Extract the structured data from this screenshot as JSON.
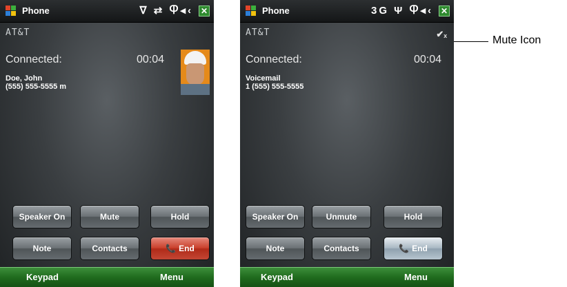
{
  "left_phone": {
    "app_title": "Phone",
    "status_icons": "ᐁ ⇄ Ⴔ◂‹",
    "close_label": "✕",
    "carrier": "AT&T",
    "call_state": "Connected:",
    "call_timer": "00:04",
    "caller_name": "Doe, John",
    "caller_number": "(555) 555-5555 m",
    "buttons": {
      "speaker": "Speaker On",
      "mute": "Mute",
      "hold": "Hold",
      "note": "Note",
      "contacts": "Contacts",
      "end": "End"
    },
    "softkeys": {
      "left": "Keypad",
      "right": "Menu"
    }
  },
  "right_phone": {
    "app_title": "Phone",
    "status_icons": "3G Ψ Ⴔ◂‹",
    "close_label": "✕",
    "carrier": "AT&T",
    "mute_indicator": "✔ₓ",
    "call_state": "Connected:",
    "call_timer": "00:04",
    "caller_name": "Voicemail",
    "caller_number": "1 (555) 555-5555",
    "buttons": {
      "speaker": "Speaker On",
      "unmute": "Unmute",
      "hold": "Hold",
      "note": "Note",
      "contacts": "Contacts",
      "end": "End"
    },
    "softkeys": {
      "left": "Keypad",
      "right": "Menu"
    }
  },
  "callout": {
    "label": "Mute Icon"
  },
  "colors": {
    "titlebar": "#1a1c1d",
    "softkey_bar": "#1f6a1d",
    "end_button_red": "#c9402c",
    "end_button_blue": "#a9b8c3"
  },
  "icons": [
    "windows-logo-icon",
    "phone-signal-icon",
    "volume-icon",
    "close-icon",
    "mute-icon",
    "handset-icon"
  ]
}
